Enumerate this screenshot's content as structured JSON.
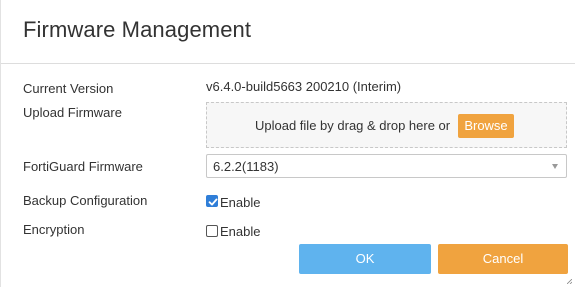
{
  "dialog": {
    "title": "Firmware Management"
  },
  "fields": {
    "current_version": {
      "label": "Current Version",
      "value": "v6.4.0-build5663 200210 (Interim)"
    },
    "upload_firmware": {
      "label": "Upload Firmware",
      "dropzone_text": "Upload file by drag & drop here or",
      "browse_label": "Browse"
    },
    "fortiguard_firmware": {
      "label": "FortiGuard Firmware",
      "selected": "6.2.2(1183)"
    },
    "backup_configuration": {
      "label": "Backup Configuration",
      "checkbox_label": "Enable",
      "checked": true
    },
    "encryption": {
      "label": "Encryption",
      "checkbox_label": "Enable",
      "checked": false
    }
  },
  "buttons": {
    "ok_label": "OK",
    "cancel_label": "Cancel"
  },
  "colors": {
    "ok_button": "#5fb3ee",
    "cancel_button": "#f0a33f",
    "browse_button": "#f0a33f",
    "checkbox_checked": "#2f7ed8"
  },
  "icons": {
    "select_arrow": "chevron-down-icon",
    "checkmark": "check-icon",
    "resize": "resize-grip-icon"
  }
}
